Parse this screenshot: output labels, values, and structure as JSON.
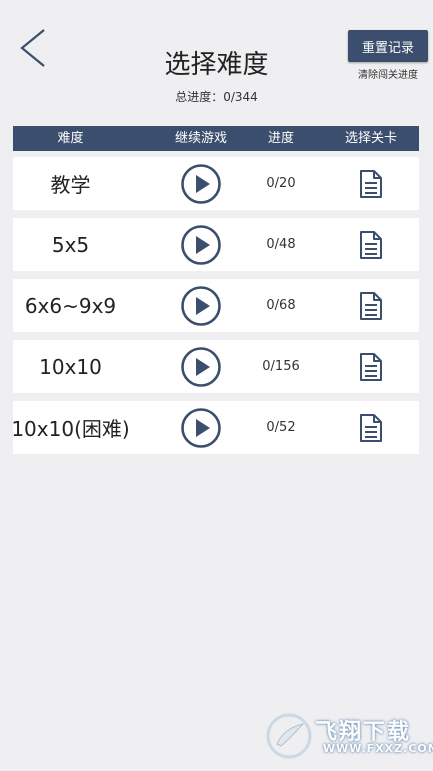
{
  "header": {
    "title": "选择难度",
    "progress_text": "总进度：0/344",
    "reset_label": "重置记录",
    "reset_note": "清除闯关进度"
  },
  "table": {
    "columns": [
      "难度",
      "继续游戏",
      "进度",
      "选择关卡"
    ],
    "rows": [
      {
        "name": "教学",
        "progress": "0/20"
      },
      {
        "name": "5x5",
        "progress": "0/48"
      },
      {
        "name": "6x6~9x9",
        "progress": "0/68"
      },
      {
        "name": "10x10",
        "progress": "0/156"
      },
      {
        "name": "10x10(困难)",
        "progress": "0/52"
      }
    ]
  },
  "watermark": {
    "text": "飞翔下载",
    "url": "WWW.FXXZ.COM"
  },
  "colors": {
    "accent": "#3c4e6d",
    "background": "#efeff1"
  },
  "icons": {
    "back": "chevron-left-icon",
    "play": "play-circle-icon",
    "level_list": "document-icon"
  }
}
